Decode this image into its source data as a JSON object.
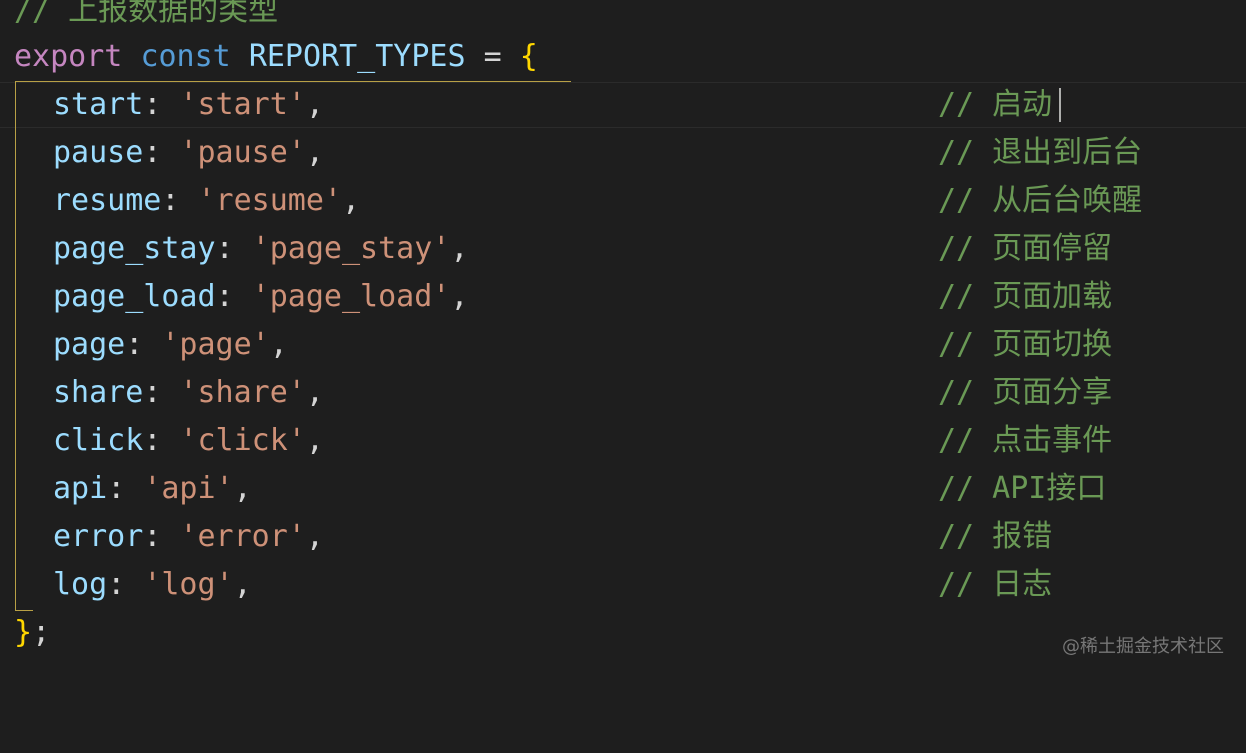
{
  "editor": {
    "header_comment": "// 上报数据的类型",
    "declaration": {
      "keyword": "export",
      "storage": "const",
      "name": "REPORT_TYPES",
      "assign": " = ",
      "open_brace": "{"
    },
    "entries": [
      {
        "key": "start",
        "value": "'start'",
        "comment": "// 启动"
      },
      {
        "key": "pause",
        "value": "'pause'",
        "comment": "// 退出到后台"
      },
      {
        "key": "resume",
        "value": "'resume'",
        "comment": "// 从后台唤醒"
      },
      {
        "key": "page_stay",
        "value": "'page_stay'",
        "comment": "// 页面停留"
      },
      {
        "key": "page_load",
        "value": "'page_load'",
        "comment": "// 页面加载"
      },
      {
        "key": "page",
        "value": "'page'",
        "comment": "// 页面切换"
      },
      {
        "key": "share",
        "value": "'share'",
        "comment": "// 页面分享"
      },
      {
        "key": "click",
        "value": "'click'",
        "comment": "// 点击事件"
      },
      {
        "key": "api",
        "value": "'api'",
        "comment": "// API接口"
      },
      {
        "key": "error",
        "value": "'error'",
        "comment": "// 报错"
      },
      {
        "key": "log",
        "value": "'log'",
        "comment": "// 日志"
      }
    ],
    "closing": "};",
    "entry_suffix": ","
  },
  "watermark": "@稀土掘金技术社区",
  "colors": {
    "background": "#1e1e1e",
    "comment": "#6a9955",
    "keyword": "#c586c0",
    "storage": "#569cd6",
    "property": "#9cdcfe",
    "string": "#ce9178",
    "brace": "#ffd700"
  }
}
